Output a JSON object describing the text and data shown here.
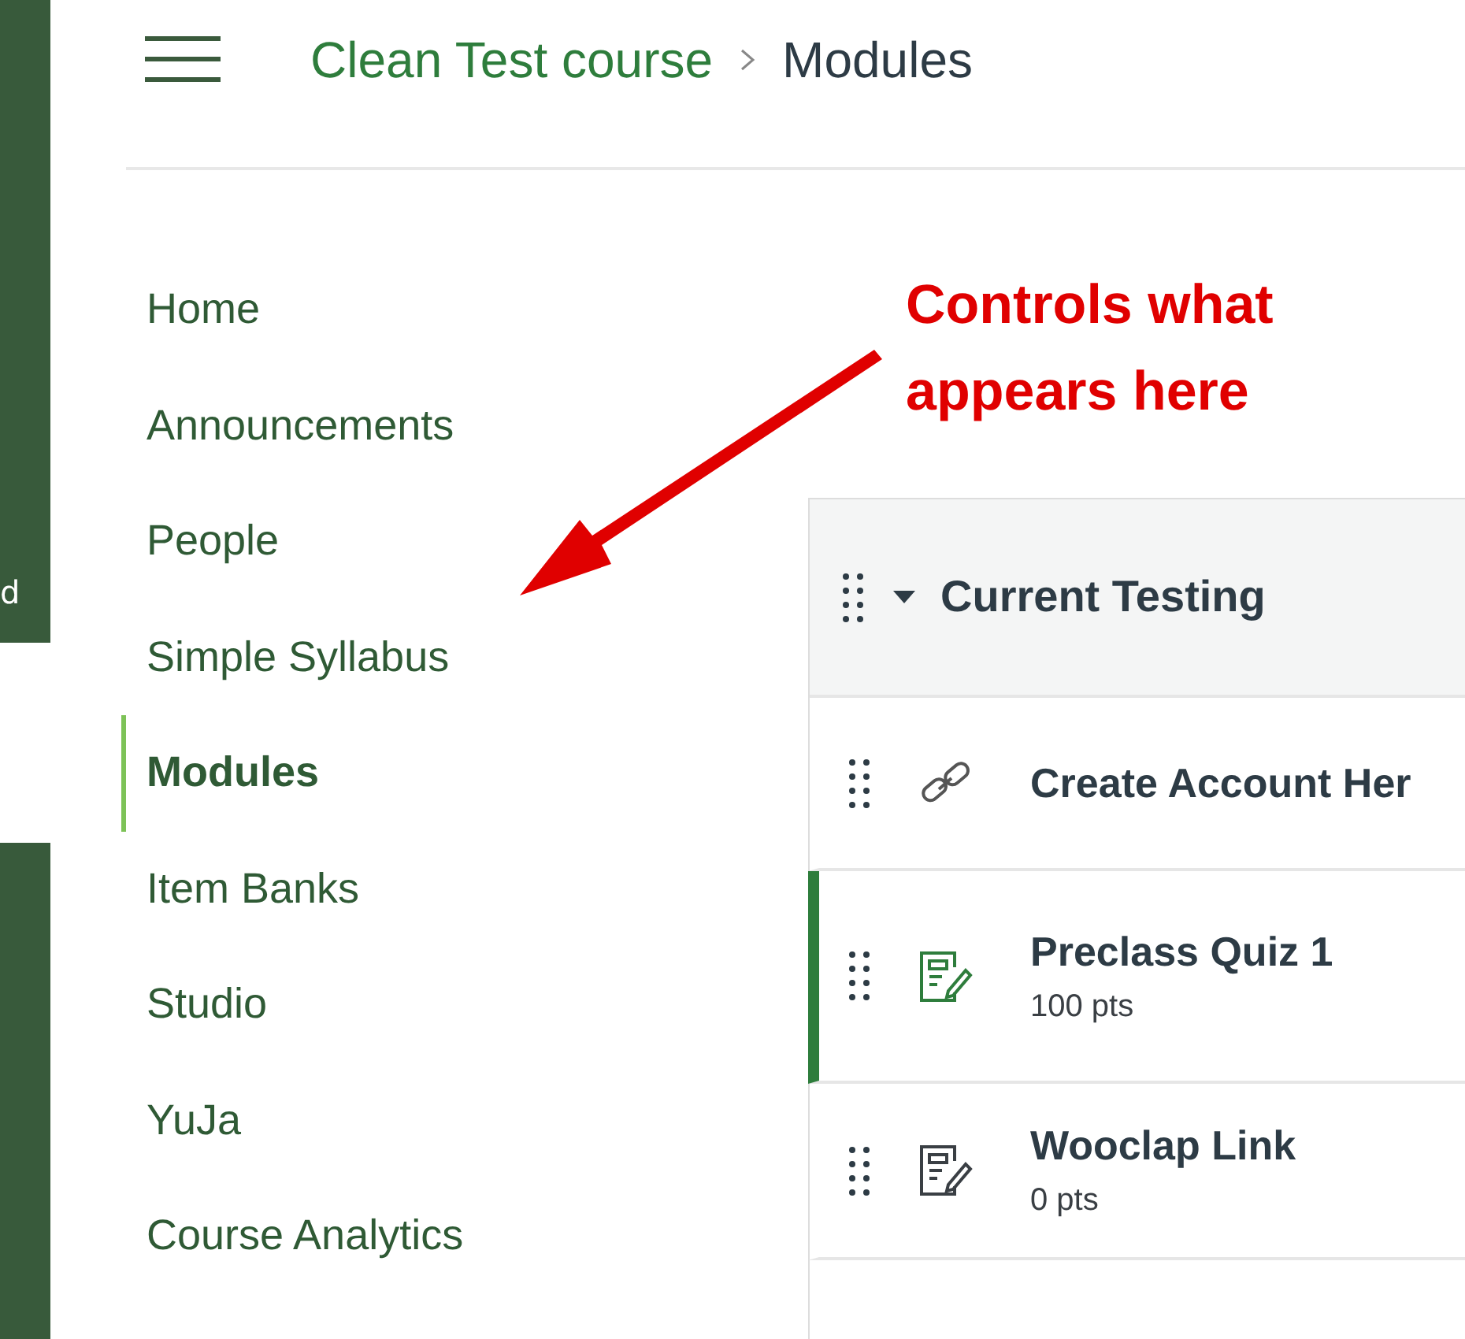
{
  "left_strip": {
    "label": "d"
  },
  "breadcrumb": [
    {
      "text": "Clean Test course",
      "kind": "link"
    },
    {
      "text": "Modules",
      "kind": "current"
    }
  ],
  "nav": [
    {
      "label": "Home",
      "selected": false
    },
    {
      "label": "Announcements",
      "selected": false
    },
    {
      "label": "People",
      "selected": false
    },
    {
      "label": "Simple Syllabus",
      "selected": false
    },
    {
      "label": "Modules",
      "selected": true
    },
    {
      "label": "Item Banks",
      "selected": false
    },
    {
      "label": "Studio",
      "selected": false
    },
    {
      "label": "YuJa",
      "selected": false
    },
    {
      "label": "Course Analytics",
      "selected": false
    }
  ],
  "annotation": {
    "text": "Controls what appears here"
  },
  "module": {
    "title": "Current Testing",
    "expanded": true,
    "items": [
      {
        "kind": "link",
        "title": "Create Account Her",
        "highlighted": false
      },
      {
        "kind": "quiz",
        "title": "Preclass Quiz 1",
        "points": "100 pts",
        "highlighted": true
      },
      {
        "kind": "quiz",
        "title": "Wooclap Link",
        "points": "0 pts",
        "highlighted": false
      }
    ]
  }
}
